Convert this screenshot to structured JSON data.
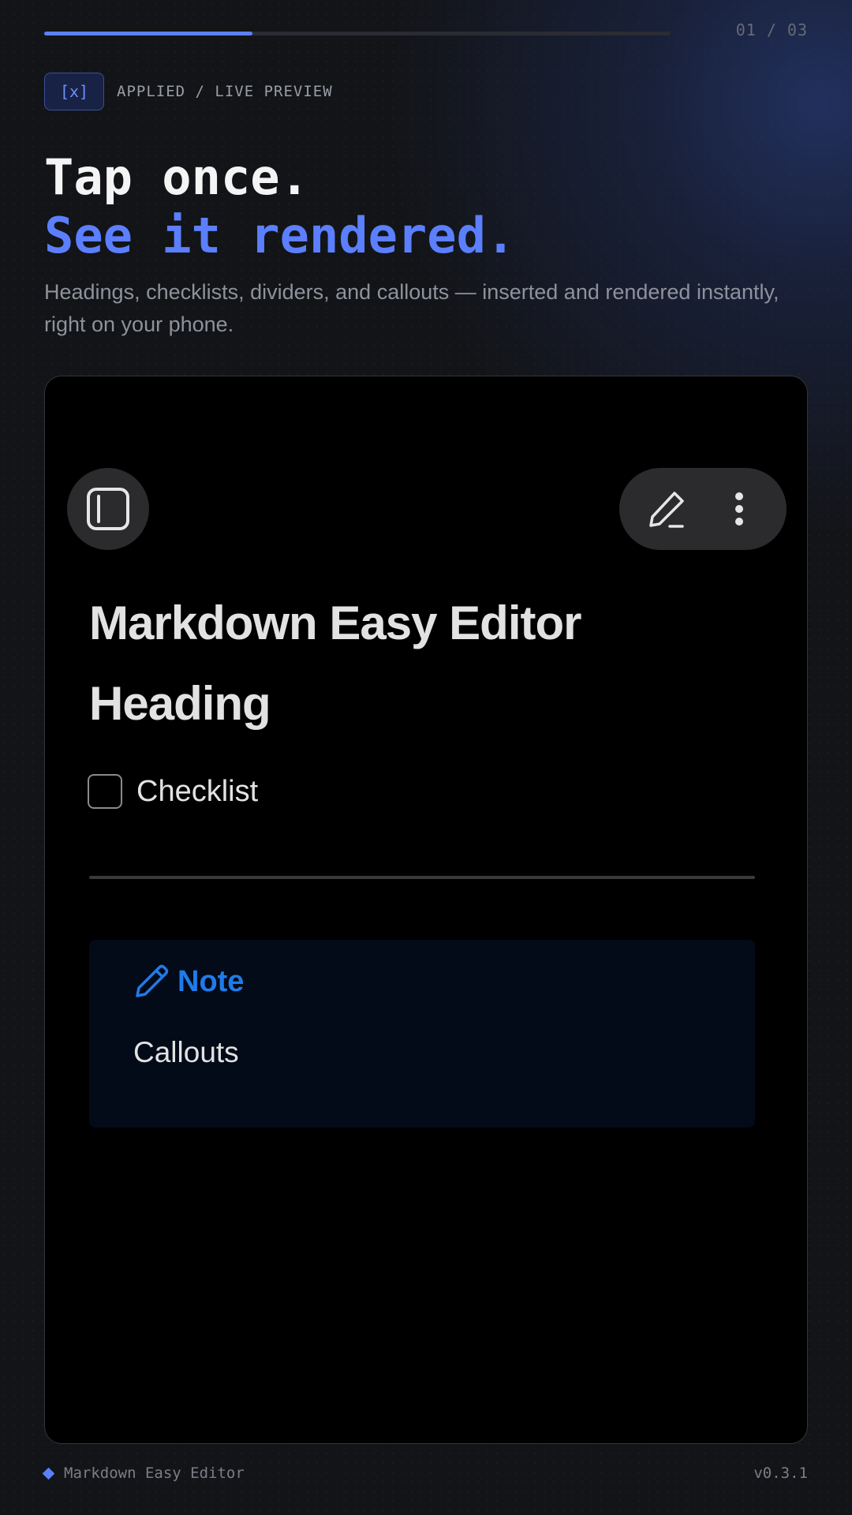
{
  "progress": {
    "step_label": "01 / 03",
    "fraction": 0.333
  },
  "eyebrow": {
    "badge": "[x]",
    "label": "APPLIED / LIVE PREVIEW"
  },
  "headline": {
    "line1": "Tap once.",
    "line2": "See it rendered."
  },
  "subtitle": "Headings, checklists, dividers, and callouts — inserted and rendered instantly, right on your phone.",
  "preview": {
    "toolbar": {
      "sidebar_icon": "sidebar-panel-icon",
      "edit_icon": "pencil-icon",
      "menu_icon": "more-vertical-icon"
    },
    "heading1": "Markdown Easy Editor",
    "heading2": "Heading",
    "checklist": {
      "label": "Checklist",
      "checked": false
    },
    "callout": {
      "icon": "pencil-icon",
      "title": "Note",
      "body": "Callouts"
    }
  },
  "footer": {
    "app_name": "Markdown Easy Editor",
    "version": "v0.3.1"
  },
  "colors": {
    "accent": "#5b7fff",
    "background": "#131417",
    "callout_accent": "#1f7bea"
  }
}
